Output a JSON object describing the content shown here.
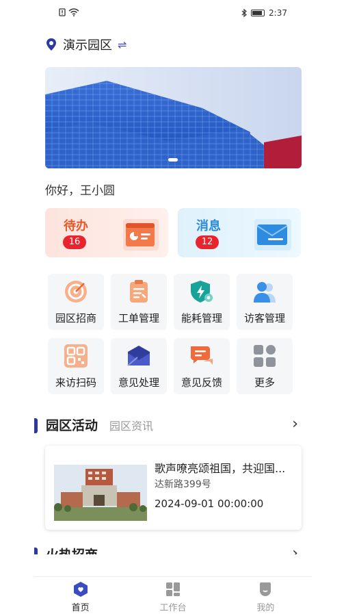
{
  "status_bar": {
    "time": "2:37"
  },
  "location": {
    "name": "演示园区",
    "swap_icon": "⇌"
  },
  "greeting": "你好，王小圆",
  "quick_cards": {
    "todo": {
      "title": "待办",
      "count": "16"
    },
    "messages": {
      "title": "消息",
      "count": "12"
    }
  },
  "grid": [
    {
      "label": "园区招商",
      "icon": "target-icon"
    },
    {
      "label": "工单管理",
      "icon": "clipboard-icon"
    },
    {
      "label": "能耗管理",
      "icon": "shield-bolt-icon"
    },
    {
      "label": "访客管理",
      "icon": "visitors-icon"
    },
    {
      "label": "来访扫码",
      "icon": "qr-code-icon"
    },
    {
      "label": "意见处理",
      "icon": "envelope-icon"
    },
    {
      "label": "意见反馈",
      "icon": "chat-bubbles-icon"
    },
    {
      "label": "更多",
      "icon": "more-grid-icon"
    }
  ],
  "activity_section": {
    "title": "园区活动",
    "secondary_tab": "园区资讯",
    "card": {
      "title": "歌声嘹亮颂祖国，共迎国...",
      "address": "达新路399号",
      "time": "2024-09-01 00:00:00"
    }
  },
  "next_section": {
    "title": "火热招商"
  },
  "tabbar": [
    {
      "label": "首页",
      "active": true
    },
    {
      "label": "工作台",
      "active": false
    },
    {
      "label": "我的",
      "active": false
    }
  ],
  "colors": {
    "accent": "#2c3aa0",
    "badge": "#e8242f"
  }
}
